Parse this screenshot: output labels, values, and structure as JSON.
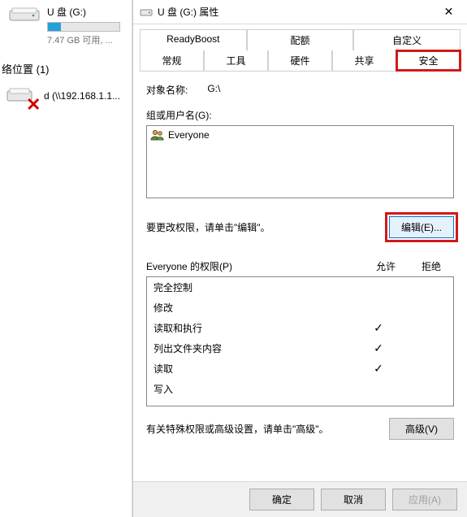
{
  "explorer": {
    "drive": {
      "title": "U 盘 (G:)",
      "subtitle": "7.47 GB 可用, ..."
    },
    "nav_label": "络位置 (1)",
    "net_item": "d (\\\\192.168.1.1..."
  },
  "dialog": {
    "title": "U 盘 (G:) 属性",
    "tabs_row1": [
      "ReadyBoost",
      "配额",
      "自定义"
    ],
    "tabs_row2": [
      "常规",
      "工具",
      "硬件",
      "共享",
      "安全"
    ],
    "object_label": "对象名称:",
    "object_value": "G:\\",
    "group_label": "组或用户名(G):",
    "group_item": "Everyone",
    "edit_hint": "要更改权限，请单击\"编辑\"。",
    "edit_btn": "编辑(E)...",
    "perm_title": "Everyone 的权限(P)",
    "perm_allow": "允许",
    "perm_deny": "拒绝",
    "perms": [
      {
        "name": "完全控制",
        "allow": false,
        "deny": false
      },
      {
        "name": "修改",
        "allow": false,
        "deny": false
      },
      {
        "name": "读取和执行",
        "allow": true,
        "deny": false
      },
      {
        "name": "列出文件夹内容",
        "allow": true,
        "deny": false
      },
      {
        "name": "读取",
        "allow": true,
        "deny": false
      },
      {
        "name": "写入",
        "allow": false,
        "deny": false
      }
    ],
    "adv_hint": "有关特殊权限或高级设置，请单击\"高级\"。",
    "adv_btn": "高级(V)",
    "ok": "确定",
    "cancel": "取消",
    "apply": "应用(A)"
  }
}
